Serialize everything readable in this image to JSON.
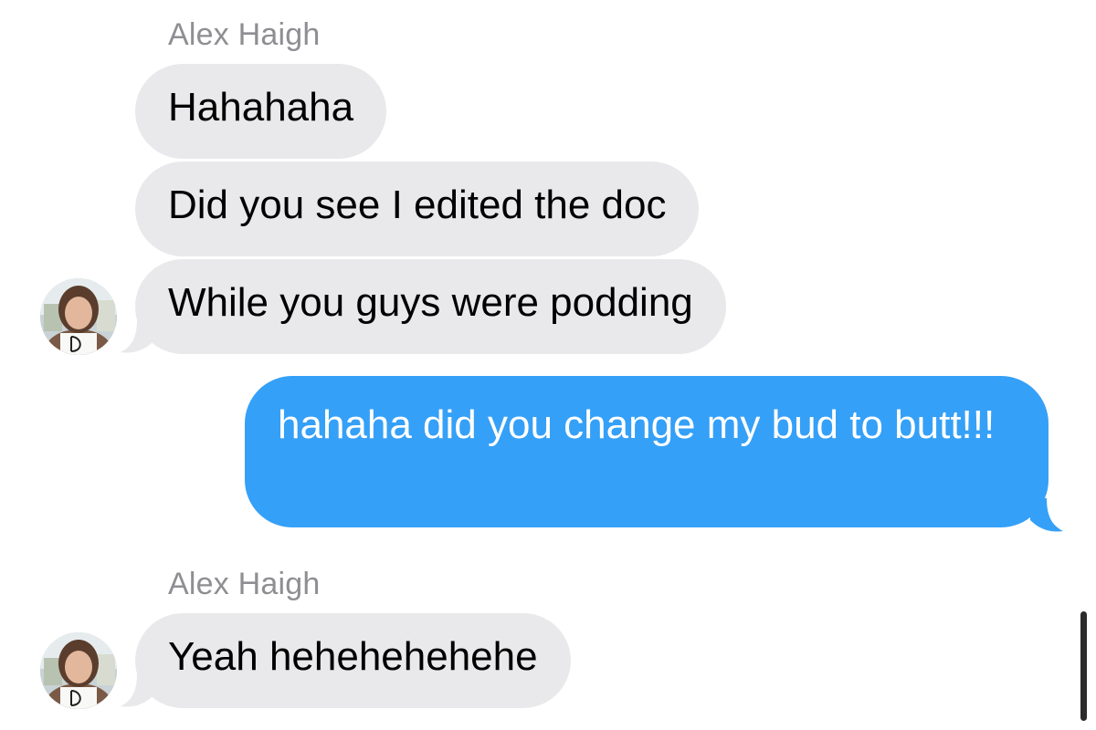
{
  "conversation": {
    "groups": [
      {
        "sender": "Alex Haigh",
        "messages": [
          "Hahahaha",
          "Did you see I edited the doc",
          "While you guys were podding"
        ]
      },
      {
        "outgoing": "hahaha did you change my bud to butt!!!"
      },
      {
        "sender": "Alex Haigh",
        "messages": [
          "Yeah hehehehehehe"
        ]
      }
    ]
  },
  "colors": {
    "incoming_bubble": "#e9e9eb",
    "outgoing_bubble": "#35a0f7",
    "sender_name": "#8e8e93"
  },
  "icons": {
    "avatar": "contact-photo-icon"
  }
}
